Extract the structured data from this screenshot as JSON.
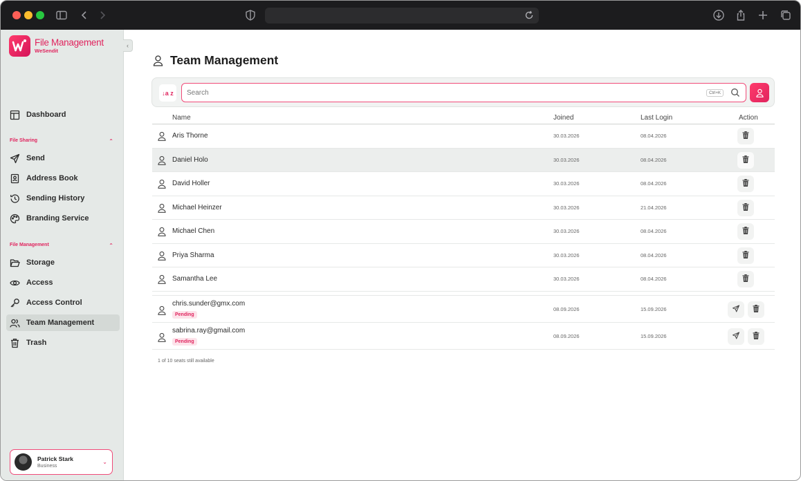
{
  "colors": {
    "accent": "#e0245e",
    "sidebar_bg": "#e5e9e7",
    "chrome_bg": "#1c1c1e"
  },
  "app": {
    "logo_title": "File Management",
    "logo_subtitle": "WeSendit"
  },
  "sidebar": {
    "dashboard": "Dashboard",
    "section_file_sharing": "File Sharing",
    "file_sharing_items": [
      {
        "label": "Send",
        "icon": "send-icon"
      },
      {
        "label": "Address Book",
        "icon": "address-book-icon"
      },
      {
        "label": "Sending History",
        "icon": "history-icon"
      },
      {
        "label": "Branding Service",
        "icon": "palette-icon"
      }
    ],
    "section_file_management": "File Management",
    "file_management_items": [
      {
        "label": "Storage",
        "icon": "folder-icon"
      },
      {
        "label": "Access",
        "icon": "eye-icon"
      },
      {
        "label": "Access Control",
        "icon": "key-icon"
      },
      {
        "label": "Team Management",
        "icon": "team-icon",
        "active": true
      },
      {
        "label": "Trash",
        "icon": "trash-icon"
      }
    ],
    "user": {
      "name": "Patrick Stark",
      "plan": "Business"
    }
  },
  "page": {
    "title": "Team Management"
  },
  "search": {
    "placeholder": "Search",
    "shortcut": "Ctrl+K",
    "sort_label": "↓a z"
  },
  "table": {
    "columns": {
      "name": "Name",
      "joined": "Joined",
      "last_login": "Last Login",
      "action": "Action"
    },
    "members": [
      {
        "name": "Aris Thorne",
        "joined": "30.03.2026",
        "last_login": "08.04.2026"
      },
      {
        "name": "Daniel Holo",
        "joined": "30.03.2026",
        "last_login": "08.04.2026"
      },
      {
        "name": "David Holler",
        "joined": "30.03.2026",
        "last_login": "08.04.2026"
      },
      {
        "name": "Michael Heinzer",
        "joined": "30.03.2026",
        "last_login": "21.04.2026"
      },
      {
        "name": "Michael Chen",
        "joined": "30.03.2026",
        "last_login": "08.04.2026"
      },
      {
        "name": "Priya Sharma",
        "joined": "30.03.2026",
        "last_login": "08.04.2026"
      },
      {
        "name": "Samantha Lee",
        "joined": "30.03.2026",
        "last_login": "08.04.2026"
      }
    ],
    "pending": [
      {
        "email": "chris.sunder@gmx.com",
        "status": "Pending",
        "joined": "08.09.2026",
        "last_login": "15.09.2026"
      },
      {
        "email": "sabrina.ray@gmail.com",
        "status": "Pending",
        "joined": "08.09.2026",
        "last_login": "15.09.2026"
      }
    ],
    "seats_text": "1 of 10 seats still available"
  }
}
